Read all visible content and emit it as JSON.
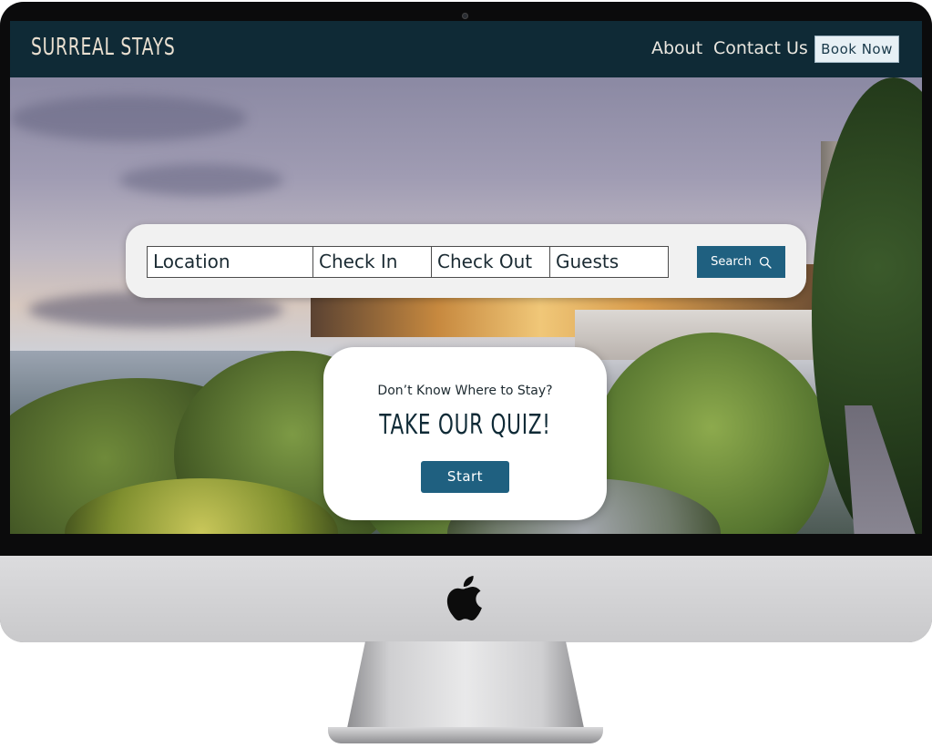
{
  "brand": {
    "name": "SURREAL STAYS"
  },
  "nav": {
    "about": "About",
    "contact": "Contact Us",
    "book_now": "Book Now"
  },
  "search": {
    "location": "Location",
    "check_in": "Check In",
    "check_out": "Check Out",
    "guests": "Guests",
    "button_label": "Search",
    "button_icon": "search-icon"
  },
  "quiz": {
    "subtitle": "Don’t Know Where to Stay?",
    "title": "TAKE OUR QUIZ!",
    "start_label": "Start"
  },
  "device": {
    "logo_icon": "apple-logo-icon"
  },
  "colors": {
    "nav_bg": "#0f2a36",
    "accent": "#1f6080",
    "brand_text": "#e9dfd0",
    "book_btn_bg": "#e7f0f5"
  }
}
